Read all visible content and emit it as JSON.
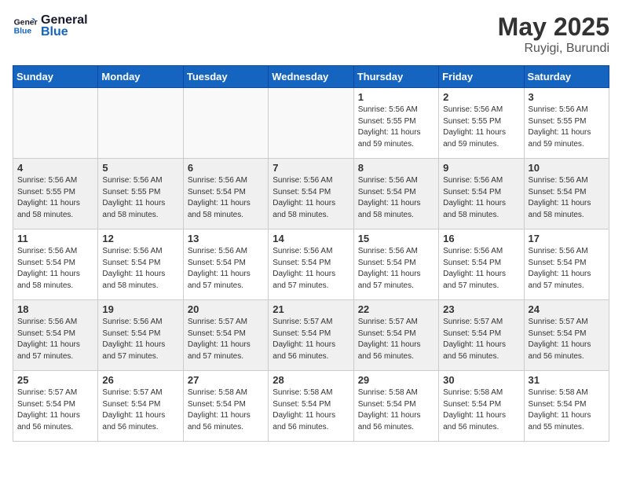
{
  "header": {
    "logo_line1": "General",
    "logo_line2": "Blue",
    "title": "May 2025",
    "subtitle": "Ruyigi, Burundi"
  },
  "weekdays": [
    "Sunday",
    "Monday",
    "Tuesday",
    "Wednesday",
    "Thursday",
    "Friday",
    "Saturday"
  ],
  "weeks": [
    [
      {
        "day": "",
        "empty": true
      },
      {
        "day": "",
        "empty": true
      },
      {
        "day": "",
        "empty": true
      },
      {
        "day": "",
        "empty": true
      },
      {
        "day": "1",
        "sunrise": "5:56 AM",
        "sunset": "5:55 PM",
        "daylight": "11 hours and 59 minutes."
      },
      {
        "day": "2",
        "sunrise": "5:56 AM",
        "sunset": "5:55 PM",
        "daylight": "11 hours and 59 minutes."
      },
      {
        "day": "3",
        "sunrise": "5:56 AM",
        "sunset": "5:55 PM",
        "daylight": "11 hours and 59 minutes."
      }
    ],
    [
      {
        "day": "4",
        "sunrise": "5:56 AM",
        "sunset": "5:55 PM",
        "daylight": "11 hours and 58 minutes."
      },
      {
        "day": "5",
        "sunrise": "5:56 AM",
        "sunset": "5:55 PM",
        "daylight": "11 hours and 58 minutes."
      },
      {
        "day": "6",
        "sunrise": "5:56 AM",
        "sunset": "5:54 PM",
        "daylight": "11 hours and 58 minutes."
      },
      {
        "day": "7",
        "sunrise": "5:56 AM",
        "sunset": "5:54 PM",
        "daylight": "11 hours and 58 minutes."
      },
      {
        "day": "8",
        "sunrise": "5:56 AM",
        "sunset": "5:54 PM",
        "daylight": "11 hours and 58 minutes."
      },
      {
        "day": "9",
        "sunrise": "5:56 AM",
        "sunset": "5:54 PM",
        "daylight": "11 hours and 58 minutes."
      },
      {
        "day": "10",
        "sunrise": "5:56 AM",
        "sunset": "5:54 PM",
        "daylight": "11 hours and 58 minutes."
      }
    ],
    [
      {
        "day": "11",
        "sunrise": "5:56 AM",
        "sunset": "5:54 PM",
        "daylight": "11 hours and 58 minutes."
      },
      {
        "day": "12",
        "sunrise": "5:56 AM",
        "sunset": "5:54 PM",
        "daylight": "11 hours and 58 minutes."
      },
      {
        "day": "13",
        "sunrise": "5:56 AM",
        "sunset": "5:54 PM",
        "daylight": "11 hours and 57 minutes."
      },
      {
        "day": "14",
        "sunrise": "5:56 AM",
        "sunset": "5:54 PM",
        "daylight": "11 hours and 57 minutes."
      },
      {
        "day": "15",
        "sunrise": "5:56 AM",
        "sunset": "5:54 PM",
        "daylight": "11 hours and 57 minutes."
      },
      {
        "day": "16",
        "sunrise": "5:56 AM",
        "sunset": "5:54 PM",
        "daylight": "11 hours and 57 minutes."
      },
      {
        "day": "17",
        "sunrise": "5:56 AM",
        "sunset": "5:54 PM",
        "daylight": "11 hours and 57 minutes."
      }
    ],
    [
      {
        "day": "18",
        "sunrise": "5:56 AM",
        "sunset": "5:54 PM",
        "daylight": "11 hours and 57 minutes."
      },
      {
        "day": "19",
        "sunrise": "5:56 AM",
        "sunset": "5:54 PM",
        "daylight": "11 hours and 57 minutes."
      },
      {
        "day": "20",
        "sunrise": "5:57 AM",
        "sunset": "5:54 PM",
        "daylight": "11 hours and 57 minutes."
      },
      {
        "day": "21",
        "sunrise": "5:57 AM",
        "sunset": "5:54 PM",
        "daylight": "11 hours and 56 minutes."
      },
      {
        "day": "22",
        "sunrise": "5:57 AM",
        "sunset": "5:54 PM",
        "daylight": "11 hours and 56 minutes."
      },
      {
        "day": "23",
        "sunrise": "5:57 AM",
        "sunset": "5:54 PM",
        "daylight": "11 hours and 56 minutes."
      },
      {
        "day": "24",
        "sunrise": "5:57 AM",
        "sunset": "5:54 PM",
        "daylight": "11 hours and 56 minutes."
      }
    ],
    [
      {
        "day": "25",
        "sunrise": "5:57 AM",
        "sunset": "5:54 PM",
        "daylight": "11 hours and 56 minutes."
      },
      {
        "day": "26",
        "sunrise": "5:57 AM",
        "sunset": "5:54 PM",
        "daylight": "11 hours and 56 minutes."
      },
      {
        "day": "27",
        "sunrise": "5:58 AM",
        "sunset": "5:54 PM",
        "daylight": "11 hours and 56 minutes."
      },
      {
        "day": "28",
        "sunrise": "5:58 AM",
        "sunset": "5:54 PM",
        "daylight": "11 hours and 56 minutes."
      },
      {
        "day": "29",
        "sunrise": "5:58 AM",
        "sunset": "5:54 PM",
        "daylight": "11 hours and 56 minutes."
      },
      {
        "day": "30",
        "sunrise": "5:58 AM",
        "sunset": "5:54 PM",
        "daylight": "11 hours and 56 minutes."
      },
      {
        "day": "31",
        "sunrise": "5:58 AM",
        "sunset": "5:54 PM",
        "daylight": "11 hours and 55 minutes."
      }
    ]
  ],
  "colors": {
    "header_bg": "#1565c0",
    "shaded_row": "#f0f0f0"
  }
}
